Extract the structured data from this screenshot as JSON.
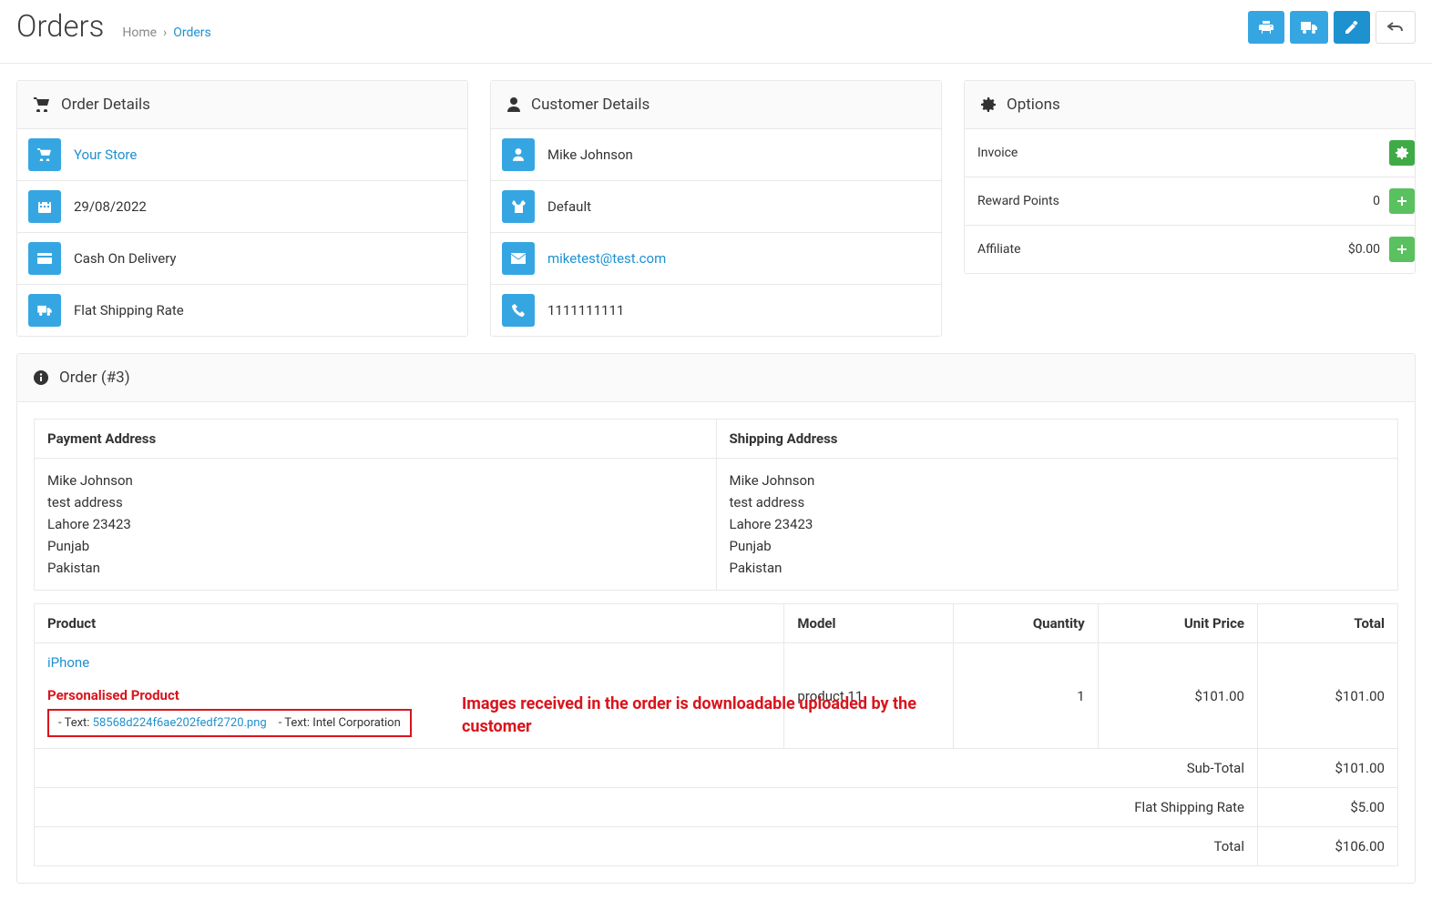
{
  "header": {
    "title": "Orders",
    "breadcrumb_home": "Home",
    "breadcrumb_sep": "›",
    "breadcrumb_current": "Orders"
  },
  "orderDetails": {
    "heading": "Order Details",
    "store": "Your Store",
    "date": "29/08/2022",
    "payment": "Cash On Delivery",
    "shipping": "Flat Shipping Rate"
  },
  "customerDetails": {
    "heading": "Customer Details",
    "name": "Mike Johnson",
    "group": "Default",
    "email": "miketest@test.com",
    "phone": "1111111111"
  },
  "options": {
    "heading": "Options",
    "invoice_label": "Invoice",
    "invoice_value": "",
    "reward_label": "Reward Points",
    "reward_value": "0",
    "affiliate_label": "Affiliate",
    "affiliate_value": "$0.00"
  },
  "orderPanel": {
    "heading": "Order (#3)",
    "addresses": {
      "payment_header": "Payment Address",
      "shipping_header": "Shipping Address",
      "name": "Mike Johnson",
      "street": "test address",
      "city": "Lahore 23423",
      "region": "Punjab",
      "country": "Pakistan"
    },
    "product_headers": {
      "product": "Product",
      "model": "Model",
      "qty": "Quantity",
      "unit": "Unit Price",
      "total": "Total"
    },
    "product": {
      "name": "iPhone",
      "personalised_label": "Personalised Product",
      "opt1_label": "- Text: ",
      "opt1_value": "58568d224f6ae202fedf2720.png",
      "opt2_label": "- Text: ",
      "opt2_value": "Intel Corporation",
      "model": "product 11",
      "qty": "1",
      "unit": "$101.00",
      "total": "$101.00"
    },
    "totals": {
      "subtotal_label": "Sub-Total",
      "subtotal_value": "$101.00",
      "shipping_label": "Flat Shipping Rate",
      "shipping_value": "$5.00",
      "total_label": "Total",
      "total_value": "$106.00"
    },
    "annotation": "Images received in the order is downloadable uploaded by the customer"
  }
}
